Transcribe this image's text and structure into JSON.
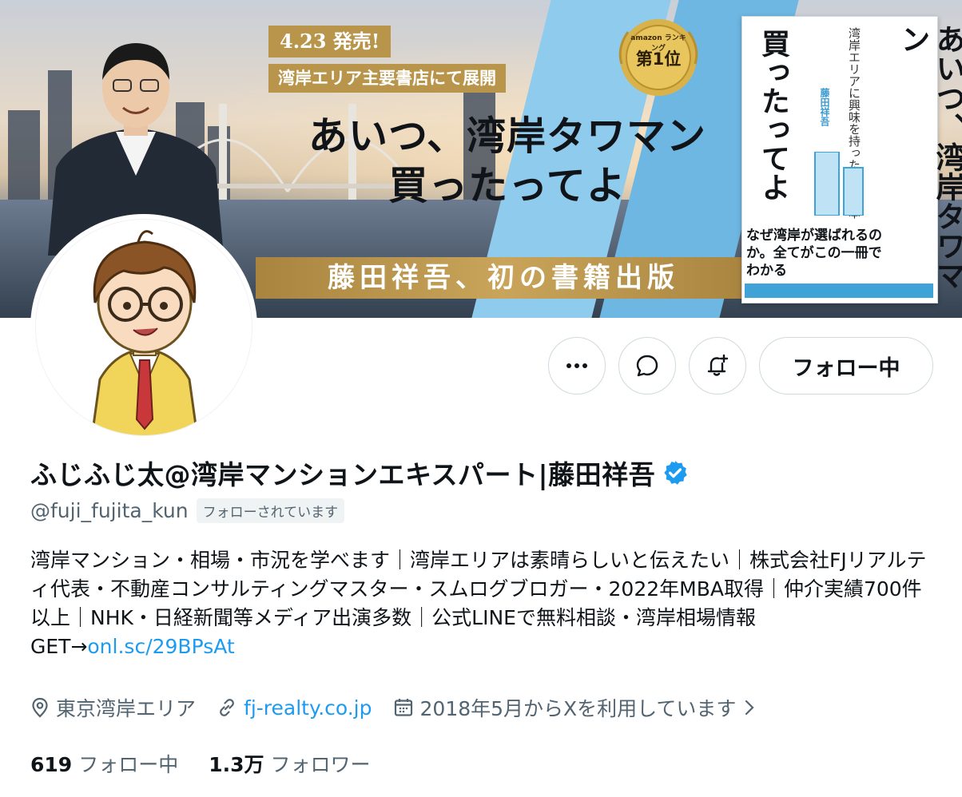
{
  "banner": {
    "date_tag": "4.23 発売!",
    "sub_tag": "湾岸エリア主要書店にて展開",
    "headline_line1": "あいつ、湾岸タワマン",
    "headline_line2": "買ったってよ",
    "gold_bar": "藤田祥吾、初の書籍出版",
    "medal_top": "amazon ランキング",
    "medal_rank": "第1位",
    "book_title_right": "あいつ、湾岸タワマン",
    "book_title_left": "買ったってよ",
    "book_small_lines": "湾岸エリアに興味を持ったら読む本",
    "book_author": "藤田祥吾",
    "book_bottom": "なぜ湾岸が選ばれるのか。全てがこの一冊でわかる"
  },
  "actions": {
    "more_icon": "more-horizontal-icon",
    "message_icon": "message-icon",
    "notify_icon": "bell-plus-icon",
    "follow_label": "フォロー中"
  },
  "profile": {
    "display_name": "ふじふじ太@湾岸マンションエキスパート|藤田祥吾",
    "verified_color": "#1d9bf0",
    "handle": "@fuji_fujita_kun",
    "follows_you": "フォローされています",
    "bio_text": "湾岸マンション・相場・市況を学べます｜湾岸エリアは素晴らしいと伝えたい｜株式会社FJリアルティ代表・不動産コンサルティングマスター・スムログブロガー・2022年MBA取得｜仲介実績700件以上｜NHK・日経新聞等メディア出演多数｜公式LINEで無料相談・湾岸相場情報GET→",
    "bio_link": "onl.sc/29BPsAt",
    "location": "東京湾岸エリア",
    "website": "fj-realty.co.jp",
    "joined": "2018年5月からXを利用しています"
  },
  "stats": {
    "following_count": "619",
    "following_label": "フォロー中",
    "followers_count": "1.3万",
    "followers_label": "フォロワー"
  },
  "colors": {
    "accent": "#1d9bf0",
    "text_primary": "#0f1419",
    "text_secondary": "#536471",
    "gold": "#b8954a"
  }
}
